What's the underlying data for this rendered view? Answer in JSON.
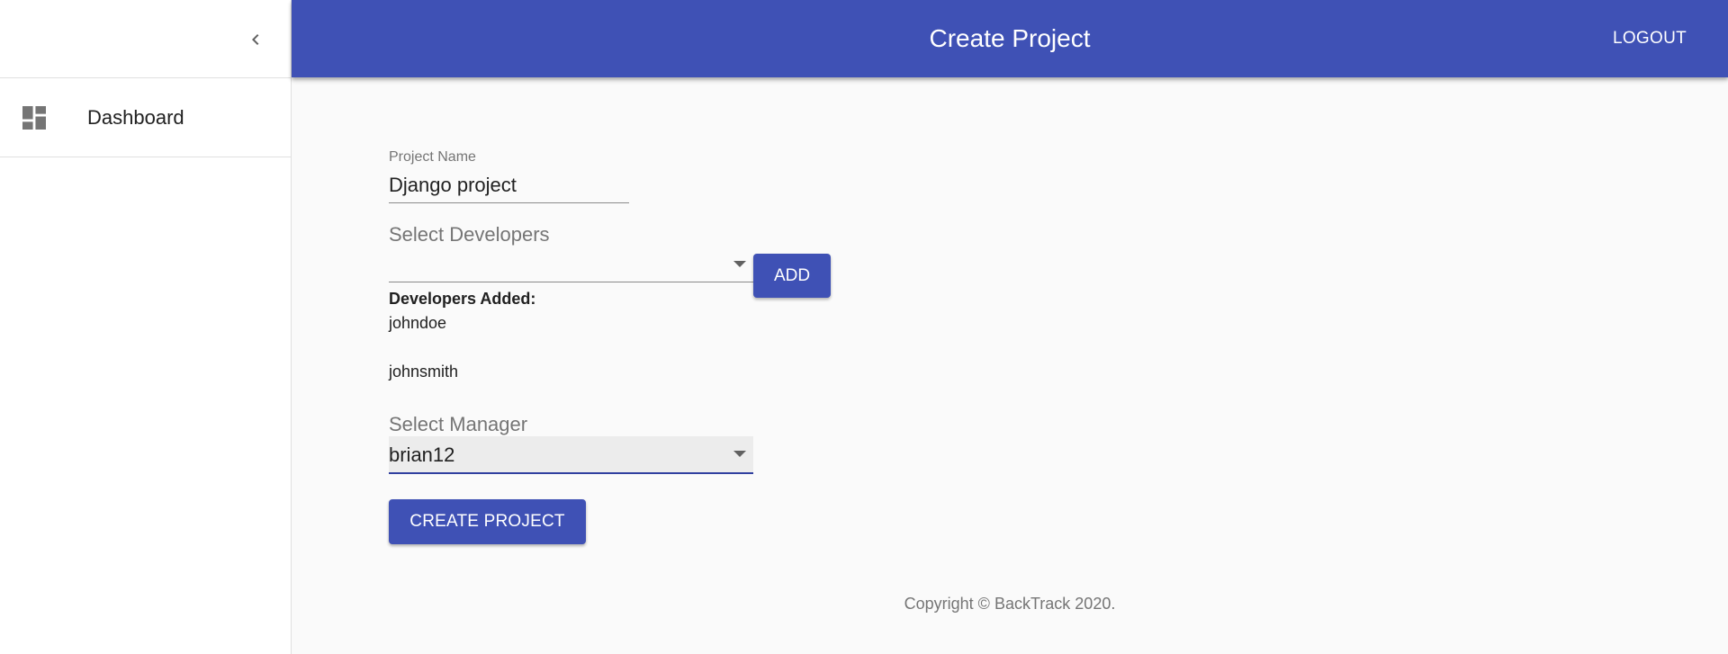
{
  "appbar": {
    "title": "Create Project",
    "logout_label": "LOGOUT",
    "color": "#3f51b5"
  },
  "sidebar": {
    "collapse_icon": "chevron-left-icon",
    "items": [
      {
        "label": "Dashboard",
        "icon": "dashboard-icon"
      }
    ]
  },
  "form": {
    "project_name_label": "Project Name",
    "project_name_value": "Django project",
    "developers_label": "Select Developers",
    "developers_value": "",
    "add_label": "ADD",
    "developers_added_header": "Developers Added:",
    "developers_added": [
      "johndoe",
      "johnsmith"
    ],
    "manager_label": "Select Manager",
    "manager_value": "brian12",
    "create_label": "CREATE PROJECT"
  },
  "footer": {
    "copyright": "Copyright © BackTrack 2020."
  }
}
